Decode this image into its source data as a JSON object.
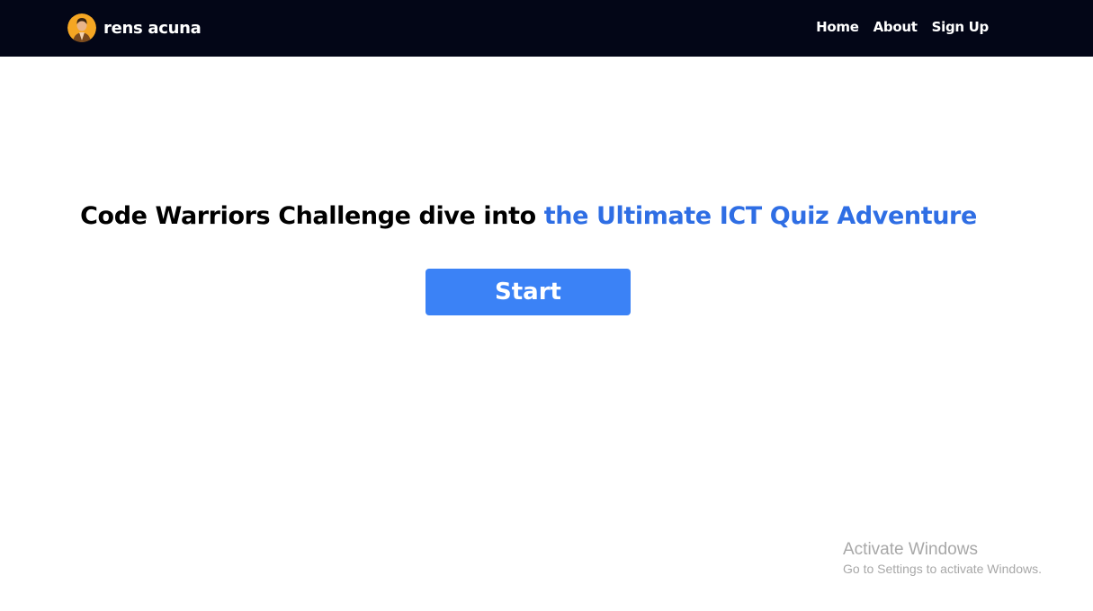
{
  "navbar": {
    "brand": {
      "name": "rens acuna",
      "avatar_icon": "user-avatar-icon"
    },
    "links": [
      {
        "label": "Home"
      },
      {
        "label": "About"
      },
      {
        "label": "Sign Up"
      }
    ]
  },
  "hero": {
    "title_prefix": "Code Warriors Challenge dive into ",
    "title_highlight": "the Ultimate ICT Quiz Adventure",
    "start_label": "Start"
  },
  "watermark": {
    "title": "Activate Windows",
    "subtitle": "Go to Settings to activate Windows."
  },
  "colors": {
    "navbar_bg": "#030617",
    "highlight": "#2f6ee4",
    "button_bg": "#3b82f6"
  }
}
